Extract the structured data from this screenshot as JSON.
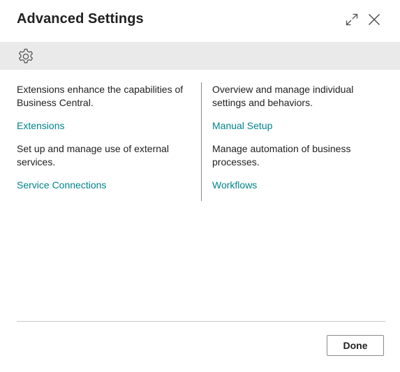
{
  "dialog": {
    "title": "Advanced Settings"
  },
  "header": {
    "expand_icon": "expand-icon",
    "close_icon": "close-icon"
  },
  "toolbar": {
    "icon": "gear-icon"
  },
  "columns": {
    "left": [
      {
        "description": "Extensions enhance the capabilities of Business Central.",
        "link": "Extensions"
      },
      {
        "description": "Set up and manage use of external services.",
        "link": "Service Connections"
      }
    ],
    "right": [
      {
        "description": "Overview and manage individual settings and behaviors.",
        "link": "Manual Setup"
      },
      {
        "description": "Manage automation of business processes.",
        "link": "Workflows"
      }
    ]
  },
  "footer": {
    "done_label": "Done"
  },
  "colors": {
    "link": "#008489",
    "toolbar_bg": "#eaeaea",
    "text": "#212121"
  }
}
